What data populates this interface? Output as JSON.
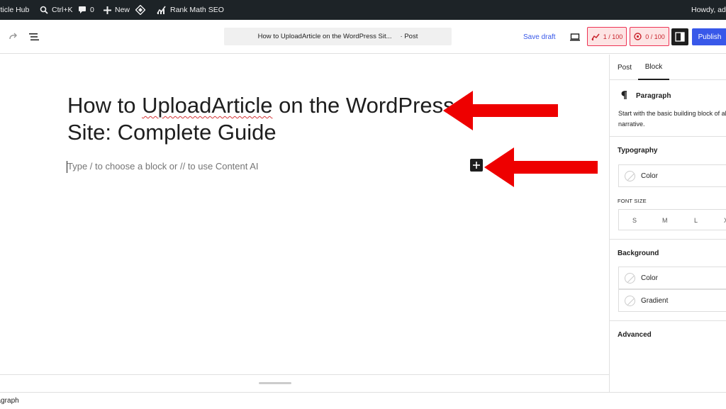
{
  "admin_bar": {
    "site_name": "Article Hub",
    "search_shortcut": "Ctrl+K",
    "comments_count": "0",
    "new_label": "New",
    "rank_math_label": "Rank Math SEO",
    "howdy": "Howdy, admin"
  },
  "toolbar": {
    "doc_title": "How to UploadArticle on the WordPress Sit...",
    "doc_type": "· Post",
    "save_draft": "Save draft",
    "seo_score": "1 / 100",
    "readability_score": "0 / 100",
    "publish": "Publish"
  },
  "editor": {
    "title_part1": "How to ",
    "title_misspelled": "UploadArticle",
    "title_part2": " on the WordPress Site: Complete Guide",
    "placeholder": "Type / to choose a block or // to use Content AI"
  },
  "sidebar": {
    "tabs": [
      "Post",
      "Block"
    ],
    "active_tab": "Block",
    "block_name": "Paragraph",
    "block_desc_line1": "Start with the basic building block of all",
    "block_desc_line2": "narrative.",
    "typography_title": "Typography",
    "typography_color": "Color",
    "font_size_label": "FONT SIZE",
    "font_sizes": [
      "S",
      "M",
      "L",
      "XL"
    ],
    "background_title": "Background",
    "background_color": "Color",
    "background_gradient": "Gradient",
    "advanced_title": "Advanced"
  },
  "statusbar": {
    "breadcrumb": "Paragraph"
  },
  "colors": {
    "admin_bar": "#1d2327",
    "accent": "#3858e9",
    "annotation_arrow": "#ee0000",
    "score_bad": "#c9252d"
  },
  "icons": [
    "wordpress-icon",
    "search-icon",
    "comment-icon",
    "plus-icon",
    "rank-math-diamond-icon",
    "rank-math-chart-icon",
    "redo-icon",
    "list-view-icon",
    "desktop-preview-icon",
    "seo-score-icon",
    "content-ai-icon",
    "sidebar-toggle-icon",
    "paragraph-icon",
    "add-block-icon"
  ]
}
